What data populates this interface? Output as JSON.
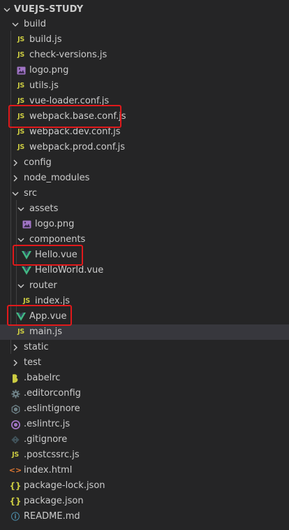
{
  "explorer": {
    "root_title": "VUEJS-STUDY",
    "tree": [
      {
        "label": "build",
        "type": "folder",
        "icon": "chevron-down-icon"
      },
      {
        "label": "build.js",
        "type": "file",
        "icon": "js-file-icon",
        "icon_text": "JS"
      },
      {
        "label": "check-versions.js",
        "type": "file",
        "icon": "js-file-icon",
        "icon_text": "JS"
      },
      {
        "label": "logo.png",
        "type": "file",
        "icon": "image-file-icon"
      },
      {
        "label": "utils.js",
        "type": "file",
        "icon": "js-file-icon",
        "icon_text": "JS"
      },
      {
        "label": "vue-loader.conf.js",
        "type": "file",
        "icon": "js-file-icon",
        "icon_text": "JS"
      },
      {
        "label": "webpack.base.conf.js",
        "type": "file",
        "icon": "js-file-icon",
        "icon_text": "JS",
        "highlighted": true
      },
      {
        "label": "webpack.dev.conf.js",
        "type": "file",
        "icon": "js-file-icon",
        "icon_text": "JS"
      },
      {
        "label": "webpack.prod.conf.js",
        "type": "file",
        "icon": "js-file-icon",
        "icon_text": "JS"
      },
      {
        "label": "config",
        "type": "folder",
        "icon": "chevron-right-icon"
      },
      {
        "label": "node_modules",
        "type": "folder",
        "icon": "chevron-right-icon"
      },
      {
        "label": "src",
        "type": "folder",
        "icon": "chevron-down-icon"
      },
      {
        "label": "assets",
        "type": "folder",
        "icon": "chevron-down-icon"
      },
      {
        "label": "logo.png",
        "type": "file",
        "icon": "image-file-icon"
      },
      {
        "label": "components",
        "type": "folder",
        "icon": "chevron-down-icon"
      },
      {
        "label": "Hello.vue",
        "type": "file",
        "icon": "vue-file-icon",
        "highlighted": true
      },
      {
        "label": "HelloWorld.vue",
        "type": "file",
        "icon": "vue-file-icon"
      },
      {
        "label": "router",
        "type": "folder",
        "icon": "chevron-down-icon"
      },
      {
        "label": "index.js",
        "type": "file",
        "icon": "js-file-icon",
        "icon_text": "JS"
      },
      {
        "label": "App.vue",
        "type": "file",
        "icon": "vue-file-icon",
        "highlighted": true
      },
      {
        "label": "main.js",
        "type": "file",
        "icon": "js-file-icon",
        "icon_text": "JS",
        "selected": true
      },
      {
        "label": "static",
        "type": "folder",
        "icon": "chevron-right-icon"
      },
      {
        "label": "test",
        "type": "folder",
        "icon": "chevron-right-icon"
      },
      {
        "label": ".babelrc",
        "type": "file",
        "icon": "babel-icon"
      },
      {
        "label": ".editorconfig",
        "type": "file",
        "icon": "gear-icon"
      },
      {
        "label": ".eslintignore",
        "type": "file",
        "icon": "eslint-icon"
      },
      {
        "label": ".eslintrc.js",
        "type": "file",
        "icon": "eslint-config-icon"
      },
      {
        "label": ".gitignore",
        "type": "file",
        "icon": "git-icon"
      },
      {
        "label": ".postcssrc.js",
        "type": "file",
        "icon": "js-file-icon",
        "icon_text": "JS"
      },
      {
        "label": "index.html",
        "type": "file",
        "icon": "html-file-icon",
        "icon_text": "<>"
      },
      {
        "label": "package-lock.json",
        "type": "file",
        "icon": "json-file-icon",
        "icon_text": "{}"
      },
      {
        "label": "package.json",
        "type": "file",
        "icon": "json-file-icon",
        "icon_text": "{}"
      },
      {
        "label": "README.md",
        "type": "file",
        "icon": "info-icon",
        "icon_text": "ⓘ"
      }
    ]
  },
  "colors": {
    "background": "#252526",
    "text": "#cccccc",
    "selected_row": "#37373d",
    "highlight_box": "#e0191b",
    "js_icon": "#cbcb41",
    "vue_icon": "#41b883",
    "image_icon": "#a074c4",
    "html_icon": "#e37933",
    "info_icon": "#519aba"
  }
}
